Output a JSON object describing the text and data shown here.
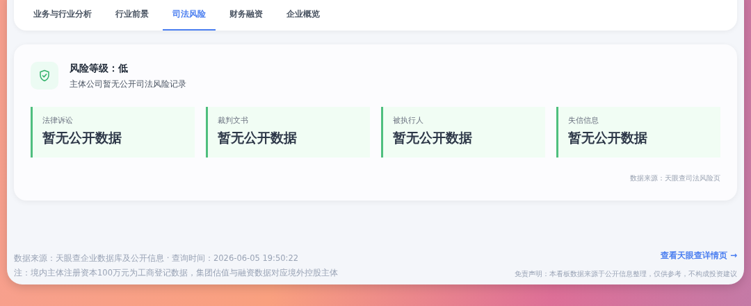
{
  "tabs": [
    {
      "label": "业务与行业分析",
      "selected": false
    },
    {
      "label": "行业前景",
      "selected": false
    },
    {
      "label": "司法风险",
      "selected": true
    },
    {
      "label": "财务融资",
      "selected": false
    },
    {
      "label": "企业概览",
      "selected": false
    }
  ],
  "risk": {
    "title": "风险等级：低",
    "subtitle": "主体公司暂无公开司法风险记录",
    "items": [
      {
        "label": "法律诉讼",
        "value": "暂无公开数据"
      },
      {
        "label": "裁判文书",
        "value": "暂无公开数据"
      },
      {
        "label": "被执行人",
        "value": "暂无公开数据"
      },
      {
        "label": "失信信息",
        "value": "暂无公开数据"
      }
    ],
    "source": "数据来源：天眼查司法风险页"
  },
  "footer": {
    "source": "数据来源：天眼查企业数据库及公开信息 · 查询时间：2026-06-05 19:50:22",
    "note": "注：境内主体注册资本100万元为工商登记数据，集团估值与融资数据对应境外控股主体",
    "link": "查看天眼查详情页 →",
    "disclaimer": "免责声明：本看板数据来源于公开信息整理，仅供参考，不构成投资建议"
  }
}
